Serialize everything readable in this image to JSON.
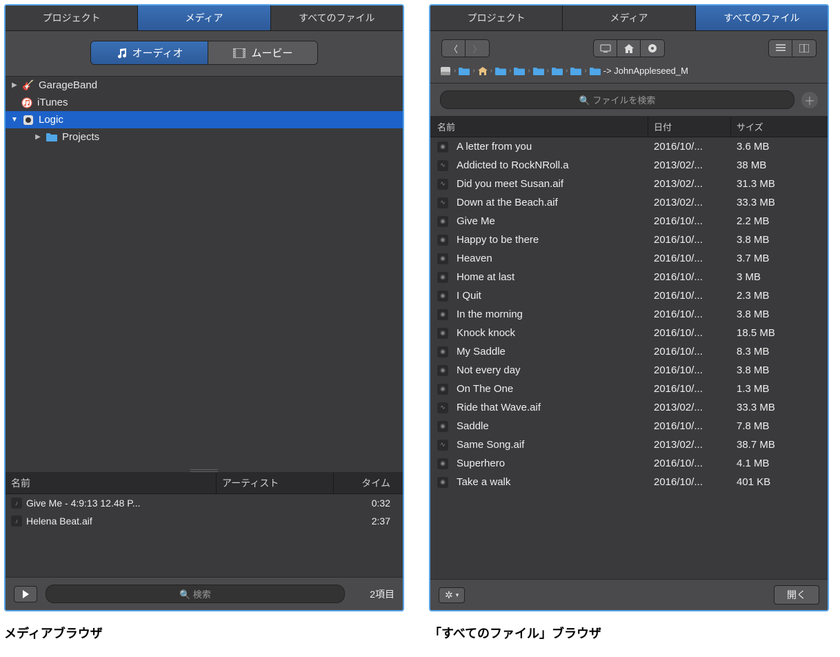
{
  "left": {
    "tabs": [
      "プロジェクト",
      "メディア",
      "すべてのファイル"
    ],
    "active_tab": 1,
    "subtabs": {
      "audio": "オーディオ",
      "movie": "ムービー"
    },
    "tree": {
      "items": [
        {
          "label": "GarageBand",
          "icon": "guitar"
        },
        {
          "label": "iTunes",
          "icon": "itunes"
        },
        {
          "label": "Logic",
          "icon": "logic",
          "selected": true,
          "expanded": true
        },
        {
          "label": "Projects",
          "icon": "folder",
          "indent": 2
        }
      ]
    },
    "list_header": {
      "name": "名前",
      "artist": "アーティスト",
      "time": "タイム"
    },
    "list": [
      {
        "name": "Give Me - 4:9:13 12.48 P...",
        "artist": "",
        "time": "0:32"
      },
      {
        "name": "Helena Beat.aif",
        "artist": "",
        "time": "2:37"
      }
    ],
    "search_placeholder": "検索",
    "count": "2項目",
    "caption": "メディアブラウザ"
  },
  "right": {
    "tabs": [
      "プロジェクト",
      "メディア",
      "すべてのファイル"
    ],
    "active_tab": 2,
    "breadcrumb_tail": "-> JohnAppleseed_M",
    "search_placeholder": "ファイルを検索",
    "file_header": {
      "name": "名前",
      "date": "日付",
      "size": "サイズ"
    },
    "files": [
      {
        "name": "A letter from you",
        "date": "2016/10/...",
        "size": "3.6 MB",
        "icon": "disc"
      },
      {
        "name": "Addicted to RockNRoll.a",
        "date": "2013/02/...",
        "size": "38 MB",
        "icon": "wave"
      },
      {
        "name": "Did you meet Susan.aif",
        "date": "2013/02/...",
        "size": "31.3 MB",
        "icon": "wave"
      },
      {
        "name": "Down at the Beach.aif",
        "date": "2013/02/...",
        "size": "33.3 MB",
        "icon": "wave"
      },
      {
        "name": "Give Me",
        "date": "2016/10/...",
        "size": "2.2 MB",
        "icon": "disc"
      },
      {
        "name": "Happy to be there",
        "date": "2016/10/...",
        "size": "3.8 MB",
        "icon": "disc"
      },
      {
        "name": "Heaven",
        "date": "2016/10/...",
        "size": "3.7 MB",
        "icon": "disc"
      },
      {
        "name": "Home at last",
        "date": "2016/10/...",
        "size": "3 MB",
        "icon": "disc"
      },
      {
        "name": "I Quit",
        "date": "2016/10/...",
        "size": "2.3 MB",
        "icon": "disc"
      },
      {
        "name": "In the morning",
        "date": "2016/10/...",
        "size": "3.8 MB",
        "icon": "disc"
      },
      {
        "name": "Knock knock",
        "date": "2016/10/...",
        "size": "18.5 MB",
        "icon": "disc"
      },
      {
        "name": "My Saddle",
        "date": "2016/10/...",
        "size": "8.3 MB",
        "icon": "disc"
      },
      {
        "name": "Not every day",
        "date": "2016/10/...",
        "size": "3.8 MB",
        "icon": "disc"
      },
      {
        "name": "On The One",
        "date": "2016/10/...",
        "size": "1.3 MB",
        "icon": "disc"
      },
      {
        "name": "Ride that Wave.aif",
        "date": "2013/02/...",
        "size": "33.3 MB",
        "icon": "wave"
      },
      {
        "name": "Saddle",
        "date": "2016/10/...",
        "size": "7.8 MB",
        "icon": "disc"
      },
      {
        "name": "Same Song.aif",
        "date": "2013/02/...",
        "size": "38.7 MB",
        "icon": "wave"
      },
      {
        "name": "Superhero",
        "date": "2016/10/...",
        "size": "4.1 MB",
        "icon": "disc"
      },
      {
        "name": "Take a walk",
        "date": "2016/10/...",
        "size": "401 KB",
        "icon": "disc"
      }
    ],
    "open_label": "開く",
    "caption": "「すべてのファイル」ブラウザ"
  }
}
